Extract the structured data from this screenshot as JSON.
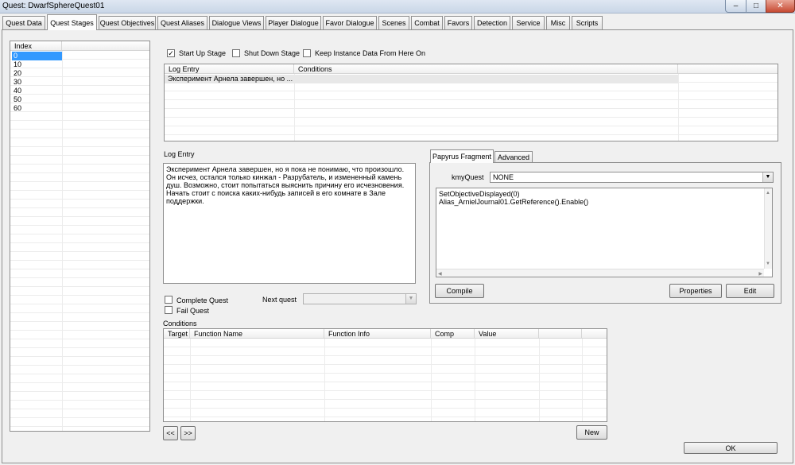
{
  "window": {
    "title": "Quest: DwarfSphereQuest01",
    "min_glyph": "‒",
    "max_glyph": "□",
    "close_glyph": "✕"
  },
  "tabs": [
    "Quest Data",
    "Quest Stages",
    "Quest Objectives",
    "Quest Aliases",
    "Dialogue Views",
    "Player Dialogue",
    "Favor Dialogue",
    "Scenes",
    "Combat",
    "Favors",
    "Detection",
    "Service",
    "Misc",
    "Scripts"
  ],
  "active_tab": "Quest Stages",
  "index_list": {
    "header": "Index",
    "items": [
      "0",
      "10",
      "20",
      "30",
      "40",
      "50",
      "60"
    ],
    "selected": "0"
  },
  "stage_flags": {
    "start_up_stage": {
      "label": "Start Up Stage",
      "checked": true,
      "mark": "✓"
    },
    "shut_down_stage": {
      "label": "Shut Down Stage",
      "checked": false,
      "mark": ""
    },
    "keep_instance": {
      "label": "Keep Instance Data From Here On",
      "checked": false,
      "mark": ""
    }
  },
  "log_table": {
    "headers": [
      "Log Entry",
      "Conditions"
    ],
    "rows": [
      {
        "log_entry": "Эксперимент Арнела завершен, но ...",
        "conditions": ""
      }
    ]
  },
  "log_entry": {
    "label": "Log Entry",
    "text": "Эксперимент Арнела завершен, но я пока не понимаю, что произошло. Он исчез, остался только кинжал - Разрубатель, и измененный камень душ. Возможно, стоит попытаться выяснить причину его исчезновения. Начать стоит с поиска каких-нибудь записей в его комнате в Зале поддержки."
  },
  "quest_end": {
    "complete_quest": {
      "label": "Complete Quest",
      "checked": false
    },
    "fail_quest": {
      "label": "Fail Quest",
      "checked": false
    },
    "next_quest_label": "Next quest",
    "next_quest_value": ""
  },
  "papyrus": {
    "tabs": [
      "Papyrus Fragment",
      "Advanced"
    ],
    "active_tab": "Papyrus Fragment",
    "quest_field_label": "kmyQuest",
    "quest_field_value": "NONE",
    "script_lines": [
      "SetObjectiveDisplayed(0)",
      "Alias_ArnielJournal01.GetReference().Enable()"
    ],
    "compile_label": "Compile",
    "properties_label": "Properties",
    "edit_label": "Edit",
    "scroll_up_glyph": "▲",
    "scroll_down_glyph": "▼",
    "scroll_left_glyph": "◀",
    "scroll_right_glyph": "▶",
    "dropdown_glyph": "▼"
  },
  "conditions": {
    "label": "Conditions",
    "headers": [
      "Target",
      "Function Name",
      "Function Info",
      "Comp",
      "Value"
    ]
  },
  "nav": {
    "prev_label": "<<",
    "next_label": ">>",
    "new_label": "New"
  },
  "ok_label": "OK"
}
